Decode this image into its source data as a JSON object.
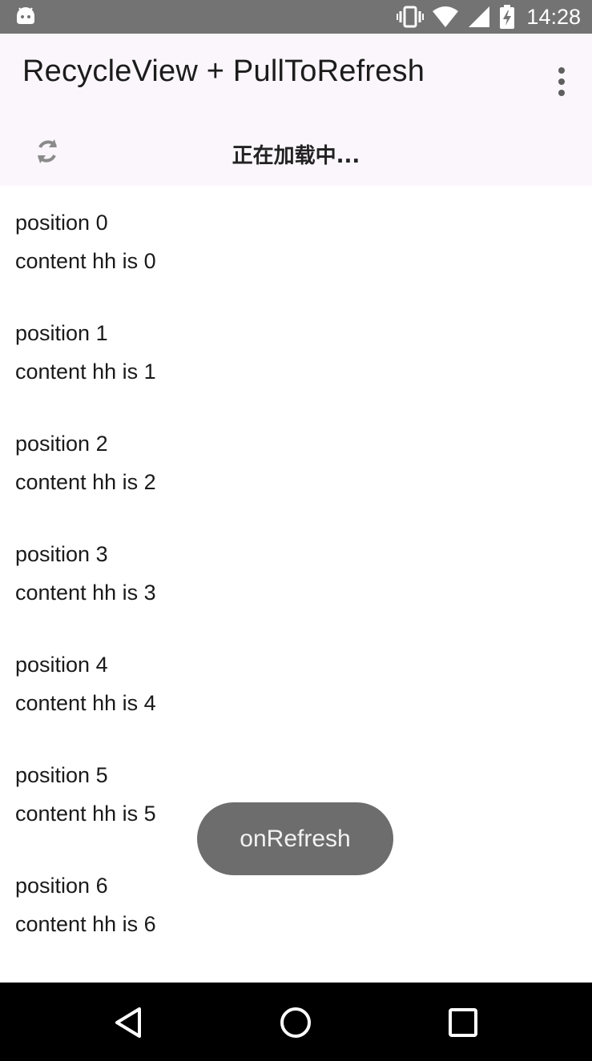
{
  "status_bar": {
    "time": "14:28",
    "icons": [
      "android-icon",
      "vibrate-icon",
      "wifi-icon",
      "signal-icon",
      "battery-charging-icon"
    ]
  },
  "app_bar": {
    "title": "RecycleView + PullToRefresh",
    "overflow_icon": "more-vert-icon"
  },
  "refresh_header": {
    "icon": "refresh-icon",
    "text": "正在加载中..."
  },
  "list": {
    "items": [
      {
        "title": "position 0",
        "content": "content hh is 0"
      },
      {
        "title": "position 1",
        "content": "content hh is 1"
      },
      {
        "title": "position 2",
        "content": "content hh is 2"
      },
      {
        "title": "position 3",
        "content": "content hh is 3"
      },
      {
        "title": "position 4",
        "content": "content hh is 4"
      },
      {
        "title": "position 5",
        "content": "content hh is 5"
      },
      {
        "title": "position 6",
        "content": "content hh is 6"
      }
    ]
  },
  "toast": {
    "text": "onRefresh"
  },
  "nav_bar": {
    "icons": [
      "back-icon",
      "home-icon",
      "recents-icon"
    ]
  },
  "colors": {
    "status_bar": "#737373",
    "app_bar": "#faf6fc",
    "toast": "#6d6d6d",
    "nav_bar": "#000000"
  }
}
